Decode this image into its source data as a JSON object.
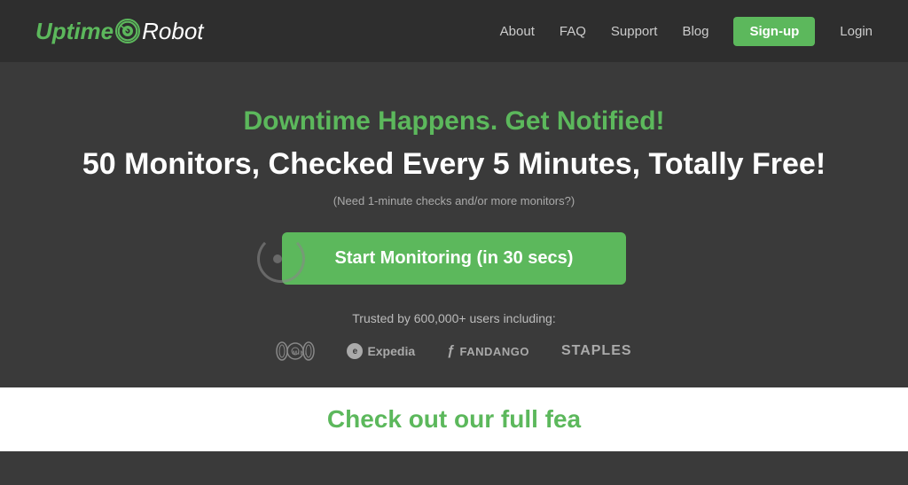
{
  "header": {
    "logo": {
      "uptime": "Uptime",
      "robot": "Robot"
    },
    "nav": {
      "about": "About",
      "faq": "FAQ",
      "support": "Support",
      "blog": "Blog",
      "signup": "Sign-up",
      "login": "Login"
    }
  },
  "hero": {
    "tagline": "Downtime Happens. Get Notified!",
    "headline": "50 Monitors, Checked Every 5 Minutes, Totally Free!",
    "subtext": "(Need 1-minute checks and/or more monitors?)",
    "cta_label": "Start Monitoring (in 30 secs)",
    "trusted_text": "Trusted by 600,000+ users including:"
  },
  "brands": [
    {
      "name": "MINI",
      "type": "mini"
    },
    {
      "name": "Expedia",
      "type": "expedia"
    },
    {
      "name": "FANDANGO",
      "type": "fandango"
    },
    {
      "name": "STAPLES",
      "type": "staples"
    }
  ],
  "bottom": {
    "headline": "Check out our full fea"
  }
}
